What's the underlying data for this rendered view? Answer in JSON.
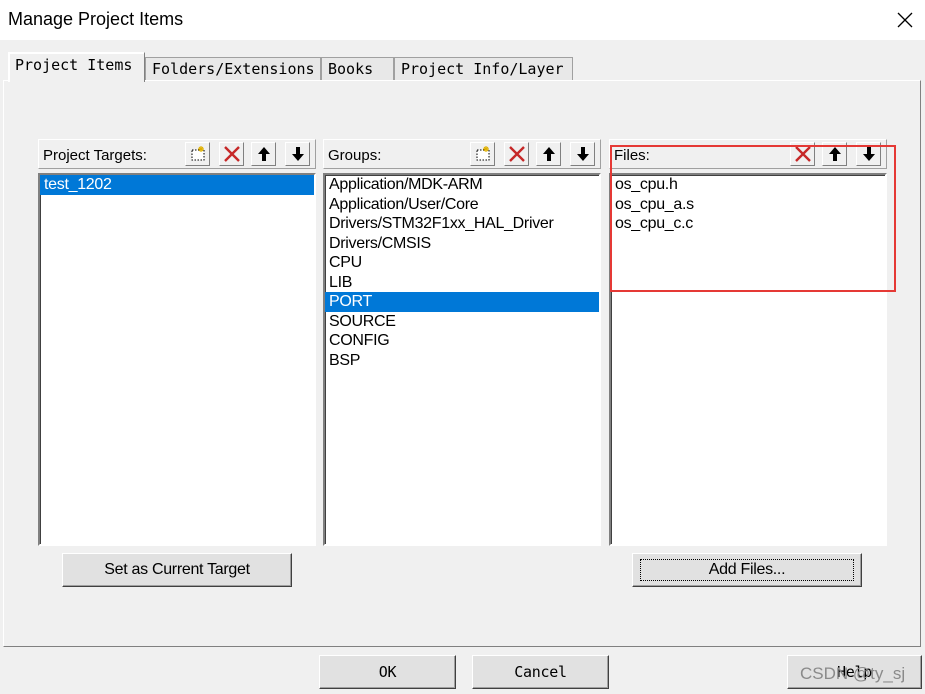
{
  "window": {
    "title": "Manage Project Items"
  },
  "tabs": [
    {
      "label": "Project Items",
      "active": true
    },
    {
      "label": "Folders/Extensions",
      "active": false
    },
    {
      "label": "Books",
      "active": false
    },
    {
      "label": "Project Info/Layer",
      "active": false
    }
  ],
  "targets": {
    "label": "Project Targets:",
    "items": [
      "test_1202"
    ],
    "selected_index": 0
  },
  "groups": {
    "label": "Groups:",
    "items": [
      "Application/MDK-ARM",
      "Application/User/Core",
      "Drivers/STM32F1xx_HAL_Driver",
      "Drivers/CMSIS",
      "CPU",
      "LIB",
      "PORT",
      "SOURCE",
      "CONFIG",
      "BSP"
    ],
    "selected_index": 6
  },
  "files": {
    "label": "Files:",
    "items": [
      "os_cpu.h",
      "os_cpu_a.s",
      "os_cpu_c.c"
    ]
  },
  "buttons": {
    "set_target": "Set as Current Target",
    "add_files": "Add Files...",
    "ok": "OK",
    "cancel": "Cancel",
    "help": "Help"
  },
  "watermark": "CSDN @ty_sj",
  "colors": {
    "selection": "#0078d7",
    "annotation": "#e53935",
    "delete_icon": "#c62828"
  }
}
